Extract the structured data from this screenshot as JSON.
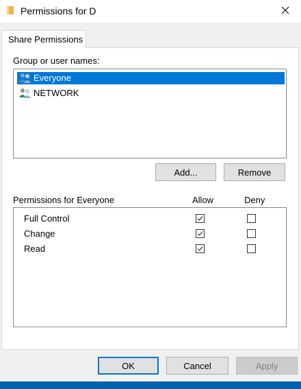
{
  "window": {
    "title": "Permissions for D"
  },
  "tabs": [
    {
      "label": "Share Permissions",
      "active": true
    }
  ],
  "users_section": {
    "label": "Group or user names:",
    "items": [
      {
        "name": "Everyone",
        "icon": "users-group-icon",
        "selected": true
      },
      {
        "name": "NETWORK",
        "icon": "network-users-icon",
        "selected": false
      }
    ],
    "add_label": "Add...",
    "remove_label": "Remove"
  },
  "permissions_section": {
    "label": "Permissions for Everyone",
    "allow_header": "Allow",
    "deny_header": "Deny",
    "rows": [
      {
        "name": "Full Control",
        "allow": true,
        "deny": false
      },
      {
        "name": "Change",
        "allow": true,
        "deny": false
      },
      {
        "name": "Read",
        "allow": true,
        "deny": false
      }
    ]
  },
  "footer": {
    "ok_label": "OK",
    "cancel_label": "Cancel",
    "apply_label": "Apply"
  },
  "colors": {
    "selection": "#0078d7",
    "taskbar": "#0063b1"
  }
}
